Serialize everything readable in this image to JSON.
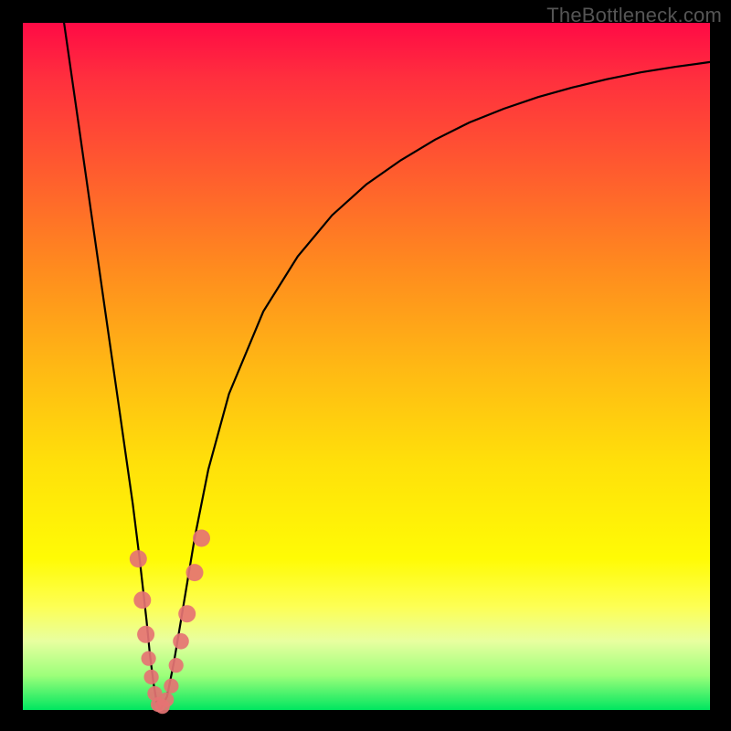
{
  "watermark": "TheBottleneck.com",
  "colors": {
    "frame": "#000000",
    "gradient_top": "#ff0a45",
    "gradient_bottom": "#00e660",
    "line": "#000000",
    "dot": "#e57373"
  },
  "chart_data": {
    "type": "line",
    "title": "",
    "xlabel": "",
    "ylabel": "",
    "xlim": [
      0,
      100
    ],
    "ylim": [
      0,
      100
    ],
    "series": [
      {
        "name": "bottleneck-curve",
        "x": [
          6,
          8,
          10,
          12,
          14,
          15,
          16,
          17,
          18,
          18.5,
          19,
          19.5,
          20,
          21,
          22,
          23,
          24,
          25,
          27,
          30,
          35,
          40,
          45,
          50,
          55,
          60,
          65,
          70,
          75,
          80,
          85,
          90,
          95,
          100
        ],
        "values": [
          100,
          86,
          72,
          58,
          44,
          37,
          30,
          22,
          13,
          8,
          4,
          1,
          0,
          2,
          7,
          13,
          19,
          25,
          35,
          46,
          58,
          66,
          72,
          76.5,
          80,
          83,
          85.5,
          87.5,
          89.2,
          90.6,
          91.8,
          92.8,
          93.6,
          94.3
        ]
      }
    ],
    "points": [
      {
        "name": "marker",
        "x": 16.8,
        "y": 22,
        "r": 1.4
      },
      {
        "name": "marker",
        "x": 17.4,
        "y": 16,
        "r": 1.4
      },
      {
        "name": "marker",
        "x": 17.9,
        "y": 11,
        "r": 1.4
      },
      {
        "name": "marker",
        "x": 18.3,
        "y": 7.5,
        "r": 1.2
      },
      {
        "name": "marker",
        "x": 18.7,
        "y": 4.8,
        "r": 1.2
      },
      {
        "name": "marker",
        "x": 19.2,
        "y": 2.4,
        "r": 1.2
      },
      {
        "name": "marker",
        "x": 19.7,
        "y": 0.8,
        "r": 1.2
      },
      {
        "name": "marker",
        "x": 20.3,
        "y": 0.5,
        "r": 1.2
      },
      {
        "name": "marker",
        "x": 20.9,
        "y": 1.5,
        "r": 1.2
      },
      {
        "name": "marker",
        "x": 21.6,
        "y": 3.5,
        "r": 1.2
      },
      {
        "name": "marker",
        "x": 22.3,
        "y": 6.5,
        "r": 1.2
      },
      {
        "name": "marker",
        "x": 23.0,
        "y": 10,
        "r": 1.3
      },
      {
        "name": "marker",
        "x": 23.9,
        "y": 14,
        "r": 1.4
      },
      {
        "name": "marker",
        "x": 25.0,
        "y": 20,
        "r": 1.4
      },
      {
        "name": "marker",
        "x": 26.0,
        "y": 25,
        "r": 1.4
      }
    ]
  }
}
